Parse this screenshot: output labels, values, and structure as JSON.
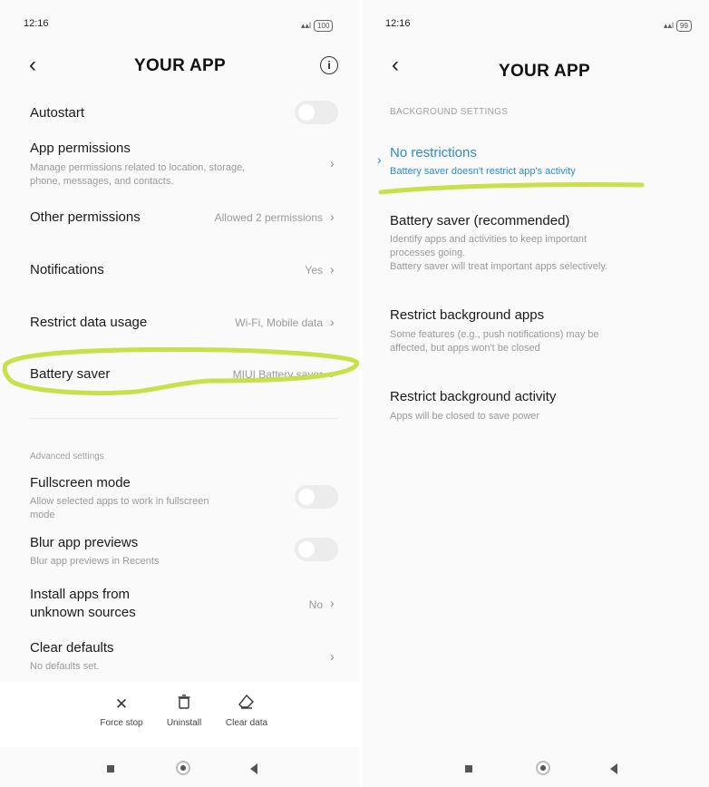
{
  "left": {
    "status_time": "12:16",
    "battery": "100",
    "title": "YOUR APP",
    "rows": {
      "autostart": {
        "title": "Autostart",
        "toggle": false
      },
      "app_permissions": {
        "title": "App permissions",
        "sub1": "Manage permissions related to location, storage,",
        "sub2": "phone, messages, and contacts."
      },
      "other_permissions": {
        "title": "Other permissions",
        "value": "Allowed 2 permissions"
      },
      "notifications": {
        "title": "Notifications",
        "value": "Yes"
      },
      "restrict_data": {
        "title": "Restrict data usage",
        "value": "Wi-Fi, Mobile data"
      },
      "battery_saver": {
        "title": "Battery saver",
        "value": "MIUI Battery saver"
      }
    },
    "advanced_label": "Advanced settings",
    "advanced": {
      "fullscreen": {
        "title": "Fullscreen mode",
        "sub1": "Allow selected apps to work in fullscreen",
        "sub2": "mode",
        "toggle": false
      },
      "blur": {
        "title": "Blur app previews",
        "sub1": "Blur app previews in Recents",
        "toggle": false
      },
      "install_unknown": {
        "title1": "Install apps from",
        "title2": "unknown sources",
        "value": "No"
      },
      "clear_defaults": {
        "title": "Clear defaults",
        "sub1": "No defaults set."
      }
    },
    "actions": {
      "force_stop": "Force stop",
      "uninstall": "Uninstall",
      "clear_data": "Clear data"
    }
  },
  "right": {
    "status_time": "12:16",
    "battery": "99",
    "title": "YOUR APP",
    "section_label": "BACKGROUND SETTINGS",
    "options": {
      "no_restrictions": {
        "title": "No restrictions",
        "sub1": "Battery saver doesn't restrict app's activity",
        "selected": true
      },
      "battery_saver": {
        "title": "Battery saver (recommended)",
        "sub1": "Identify apps and activities to keep important",
        "sub2": "processes going.",
        "sub3": "Battery saver will treat important apps selectively."
      },
      "restrict_bg_apps": {
        "title": "Restrict background apps",
        "sub1": "Some features (e.g., push notifications) may be",
        "sub2": "affected, but apps won't be closed"
      },
      "restrict_bg_activity": {
        "title": "Restrict background activity",
        "sub1": "Apps will be closed to save power"
      }
    }
  },
  "colors": {
    "accent": "#2a8bd4",
    "highlight": "#c8e04a",
    "background": "#fafafa"
  },
  "icons": [
    "back-chevron-icon",
    "info-icon",
    "chevron-right-icon",
    "close-icon",
    "trash-icon",
    "eraser-icon",
    "recents-square-icon",
    "home-circle-icon",
    "back-triangle-icon",
    "signal-icon",
    "battery-icon"
  ]
}
